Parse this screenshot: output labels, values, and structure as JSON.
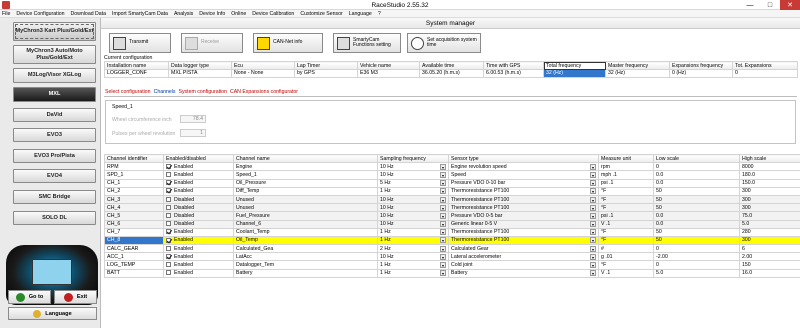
{
  "window": {
    "title": "RaceStudio 2.55.32",
    "min": "—",
    "max": "□",
    "close": "✕"
  },
  "menu": [
    "File",
    "Device Configuration",
    "Download Data",
    "Import SmartyCam Data",
    "Analysis",
    "Device Info",
    "Online",
    "Device Calibration",
    "Customize Sensor",
    "Language",
    "?"
  ],
  "sidebar": {
    "devices": [
      "MyChron3 Kart Plus/Gold/Ext",
      "MyChron3 Auto/Moto Plus/Gold/Ext",
      "M3Log/Visor XGLog",
      "MXL",
      "DaVid",
      "EVO3",
      "EVO3 Pro/Pista",
      "EVO4",
      "SMC Bridge",
      "SOLO DL"
    ],
    "goto_label": "Go to",
    "exit_label": "Exit",
    "language_label": "Language"
  },
  "system_manager": {
    "title": "System manager",
    "toolbar": {
      "transmit": "Transmit",
      "receive": "Receive",
      "can_info": "CAN-Net info",
      "smartycam": "SmartyCam Functions setting",
      "acq_time": "Set acquisition system time"
    },
    "current_config_label": "Current configuration",
    "config_headers": [
      "Installation name",
      "Data logger type",
      "Ecu",
      "Lap Timer",
      "Vehicle name",
      "Available time",
      "Time with GPS",
      "Total frequency",
      "Master frequency",
      "Expansions frequency",
      "Tot. Expansions"
    ],
    "config_values": [
      "LOGGER_CONF",
      "MXL PISTA",
      "None - None",
      "by GPS",
      "E36 M3",
      "36.05.20 (h.m.s)",
      "6.00.53 (h.m.s)",
      "32 (Hz)",
      "32 (Hz)",
      "0 (Hz)",
      "0"
    ],
    "tabs": [
      "Select configuration",
      "Channels",
      "System configuration",
      "CAN Expansions configurator"
    ],
    "speed_box": {
      "title": "Speed_1",
      "wheel_label": "Wheel circumference  inch",
      "wheel_value": "78.4",
      "pulses_label": "Pulses per wheel revolution",
      "pulses_value": "1"
    },
    "channel_headers": [
      "Channel identifier",
      "Enabled/disabled",
      "Channel name",
      "Sampling frequency",
      "Sensor type",
      "Measure unit",
      "Low scale",
      "High scale"
    ],
    "channels": [
      {
        "id": "RPM",
        "enabled": true,
        "status": "Enabled",
        "name": "Engine",
        "freq": "10 Hz",
        "sensor": "Engine revolution speed",
        "unit": "rpm",
        "low": "0",
        "high": "8000"
      },
      {
        "id": "SPD_1",
        "enabled": false,
        "status": "Enabled",
        "name": "Speed_1",
        "freq": "10 Hz",
        "sensor": "Speed",
        "unit": "mph  .1",
        "low": "0.0",
        "high": "180.0"
      },
      {
        "id": "CH_1",
        "enabled": true,
        "status": "Enabled",
        "name": "Oil_Pressure",
        "freq": "5 Hz",
        "sensor": "Pressure VDO 0-10 bar",
        "unit": "psi  .1",
        "low": "0.0",
        "high": "150.0"
      },
      {
        "id": "CH_2",
        "enabled": true,
        "status": "Enabled",
        "name": "Diff_Temp",
        "freq": "1 Hz",
        "sensor": "Thermoresistance PT100",
        "unit": "°F",
        "low": "50",
        "high": "300"
      },
      {
        "id": "CH_3",
        "enabled": false,
        "status": "Disabled",
        "name": "Unused",
        "freq": "10 Hz",
        "sensor": "Thermoresistance PT100",
        "unit": "°F",
        "low": "50",
        "high": "300"
      },
      {
        "id": "CH_4",
        "enabled": false,
        "status": "Disabled",
        "name": "Unused",
        "freq": "10 Hz",
        "sensor": "Thermoresistance PT100",
        "unit": "°F",
        "low": "50",
        "high": "300"
      },
      {
        "id": "CH_5",
        "enabled": false,
        "status": "Disabled",
        "name": "Fuel_Pressure",
        "freq": "10 Hz",
        "sensor": "Pressure VDO 0-5 bar",
        "unit": "psi  .1",
        "low": "0.0",
        "high": "75.0"
      },
      {
        "id": "CH_6",
        "enabled": false,
        "status": "Disabled",
        "name": "Channel_6",
        "freq": "10 Hz",
        "sensor": "Generic linear 0-5 V",
        "unit": "V  .1",
        "low": "0.0",
        "high": "5.0"
      },
      {
        "id": "CH_7",
        "enabled": true,
        "status": "Enabled",
        "name": "Coolant_Temp",
        "freq": "1 Hz",
        "sensor": "Thermoresistance PT100",
        "unit": "°F",
        "low": "50",
        "high": "280"
      },
      {
        "id": "CH_8",
        "enabled": true,
        "status": "Enabled",
        "name": "Oil_Temp",
        "freq": "1 Hz",
        "sensor": "Thermoresistance PT100",
        "unit": "°F",
        "low": "50",
        "high": "300"
      },
      {
        "id": "CALC_GEAR",
        "enabled": false,
        "status": "Enabled",
        "name": "Calculated_Gea",
        "freq": "2 Hz",
        "sensor": "Calculated Gear",
        "unit": "#",
        "low": "0",
        "high": "6"
      },
      {
        "id": "ACC_1",
        "enabled": true,
        "status": "Enabled",
        "name": "LatAcc",
        "freq": "10 Hz",
        "sensor": "Lateral accelerometer",
        "unit": "g  .01",
        "low": "-2.00",
        "high": "2.00"
      },
      {
        "id": "LOG_TEMP",
        "enabled": false,
        "status": "Enabled",
        "name": "Datalogger_Tem",
        "freq": "1 Hz",
        "sensor": "Cold joint",
        "unit": "°F",
        "low": "0",
        "high": "150"
      },
      {
        "id": "BATT",
        "enabled": false,
        "status": "Enabled",
        "name": "Battery",
        "freq": "1 Hz",
        "sensor": "Battery",
        "unit": "V  .1",
        "low": "5.0",
        "high": "16.0"
      }
    ]
  }
}
